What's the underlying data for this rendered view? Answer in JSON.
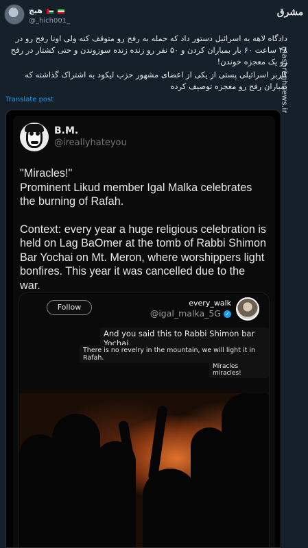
{
  "header": {
    "display_name": "هیچ",
    "handle": "@_hich001_"
  },
  "brand": {
    "logo": "مشرق",
    "site": "mashreghnews.ir"
  },
  "post": {
    "paragraph1": "دادگاه لاهه به اسرائیل دستور داد که حمله به رفح رو متوقف کنه ولی اونا رفح رو در ۴۸ ساعت ۶۰ بار بمباران کردن و ۵۰ نفر رو زنده زنده سوزوندن و حتی کشتار در رفح رو یک معجزه خوندن!",
    "paragraph2": "کاربر اسرائیلی پستی از یکی از اعضای مشهور حزب لیکود به اشتراک گذاشته که بمباران رفح رو معجزه توصیف کرده",
    "translate_label": "Translate post"
  },
  "embed": {
    "name": "B.M.",
    "handle": "@ireallyhateyou",
    "line1": "\"Miracles!\"",
    "line2": "Prominent Likud member Igal Malka celebrates the burning of Rafah.",
    "context": "Context: every year a huge religious celebration is held on Lag BaOmer at the tomb of Rabbi Shimon Bar Yochai on Mt. Meron, where worshippers light bonfires. This year it was cancelled due to the war."
  },
  "video": {
    "follow_label": "Follow",
    "name1": "every_walk",
    "name2": "@igal_malka_5G",
    "caption1": "And you said this to Rabbi Shimon bar Yochai.",
    "caption2": "There is no revelry in the mountain, we will light it in Rafah.",
    "caption3": "Miracles miracles!"
  },
  "icons": {
    "verified": "verified-badge-icon"
  },
  "colors": {
    "background": "#15202b",
    "link": "#1d9bf0"
  }
}
